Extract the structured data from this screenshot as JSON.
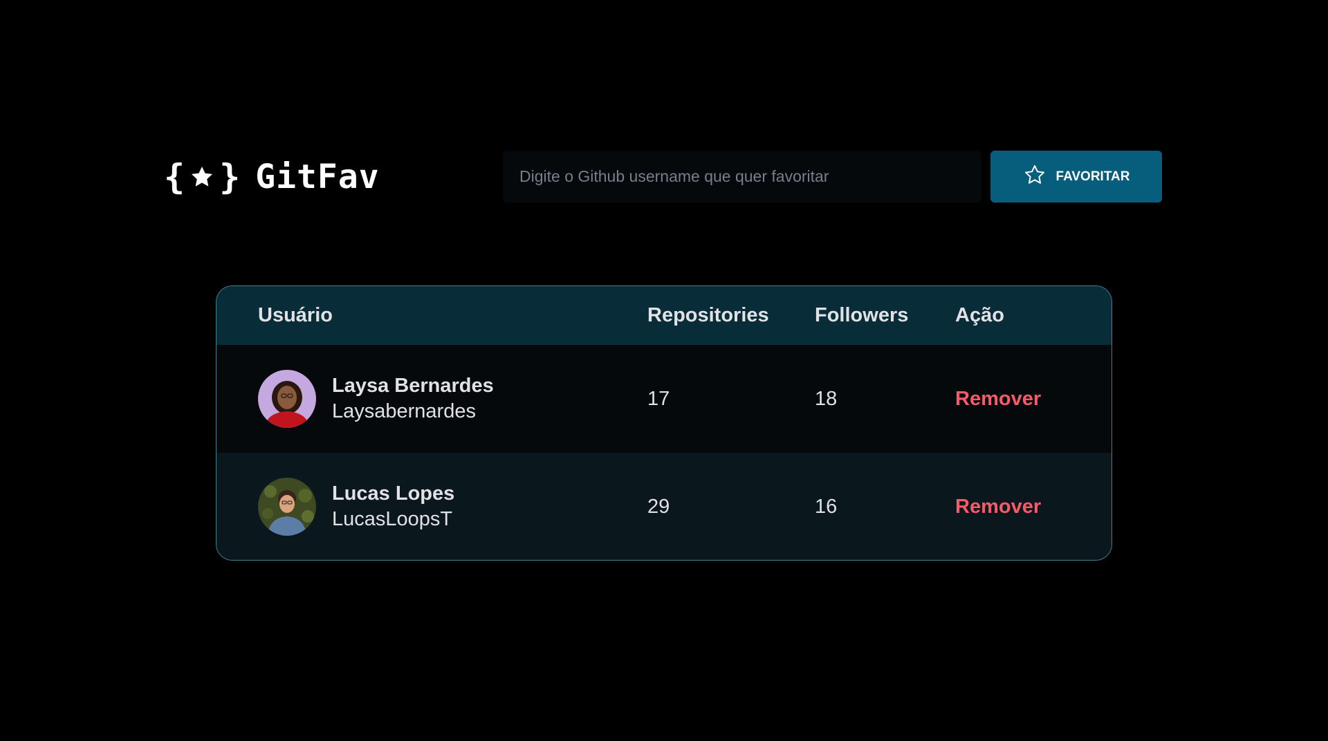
{
  "header": {
    "logo_text": "GitFav",
    "logo_icon": "braces-star-icon",
    "search": {
      "placeholder": "Digite o Github username que quer favoritar",
      "value": ""
    },
    "favorite_button": {
      "label": "FAVORITAR",
      "icon": "star-outline-icon",
      "color": "#065E7C"
    }
  },
  "table": {
    "columns": {
      "user": "Usuário",
      "repositories": "Repositories",
      "followers": "Followers",
      "action": "Ação"
    },
    "rows": [
      {
        "name": "Laysa Bernardes",
        "login": "Laysabernardes",
        "repositories": "17",
        "followers": "18",
        "action_label": "Remover"
      },
      {
        "name": "Lucas Lopes",
        "login": "LucasLoopsT",
        "repositories": "29",
        "followers": "16",
        "action_label": "Remover"
      }
    ],
    "colors": {
      "header_bg": "#092D38",
      "row_odd_bg": "#06090C",
      "row_even_bg": "#0A171D",
      "remove": "#F75A68"
    }
  }
}
